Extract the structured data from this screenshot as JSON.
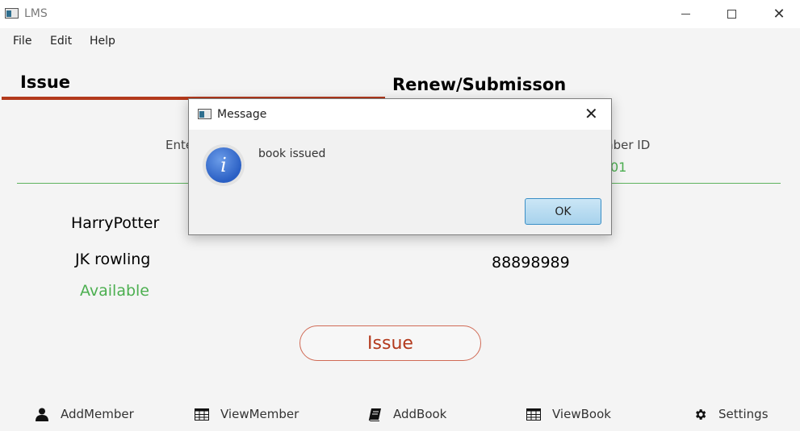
{
  "window": {
    "title": "LMS"
  },
  "menu": {
    "items": [
      "File",
      "Edit",
      "Help"
    ]
  },
  "tabs": {
    "issue_label": "Issue",
    "renew_label": "Renew/Submisson"
  },
  "form": {
    "book_id_label_partial": "Ente",
    "member_id_label_partial": "mber ID",
    "member_id_value_partial": "01"
  },
  "book": {
    "name": "HarryPotter",
    "author": "JK rowling",
    "status": "Available"
  },
  "member": {
    "mobile": "88898989"
  },
  "actions": {
    "issue_label": "Issue"
  },
  "bottom_nav": {
    "add_member": "AddMember",
    "view_member": "ViewMember",
    "add_book": "AddBook",
    "view_book": "ViewBook",
    "settings": "Settings"
  },
  "dialog": {
    "title": "Message",
    "message": "book issued",
    "ok_label": "OK",
    "icon_letter": "i"
  },
  "colors": {
    "accent": "#b3391c",
    "success": "#4caf50"
  }
}
